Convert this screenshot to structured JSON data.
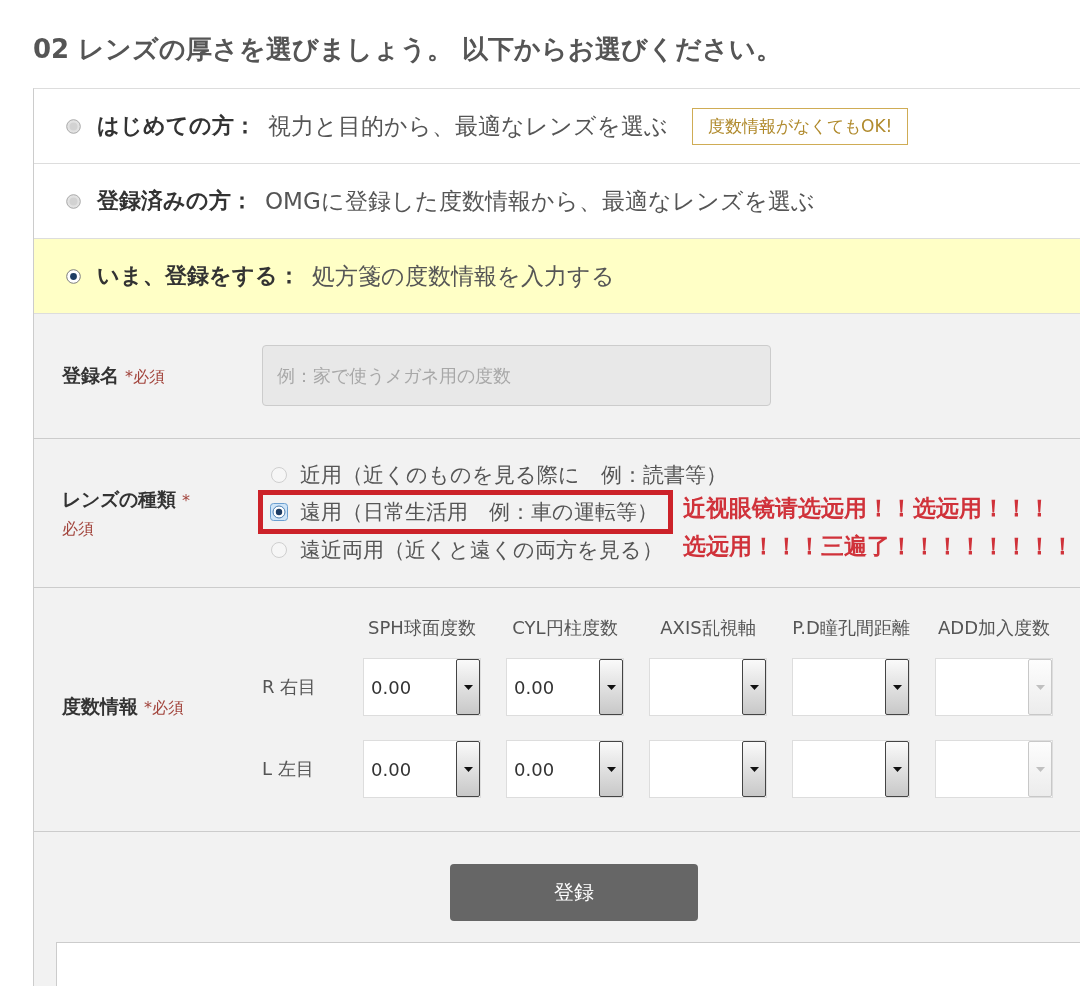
{
  "heading": "02 レンズの厚さを選びましょう。 以下からお選びください。",
  "options": [
    {
      "title": "はじめての方：",
      "description": "視力と目的から、最適なレンズを選ぶ",
      "badge": "度数情報がなくてもOK!",
      "selected": false
    },
    {
      "title": "登録済みの方：",
      "description": "OMGに登録した度数情報から、最適なレンズを選ぶ",
      "selected": false
    },
    {
      "title": "いま、登録をする：",
      "description": "処方箋の度数情報を入力する",
      "selected": true
    }
  ],
  "registration_name": {
    "label": "登録名",
    "required": "*必須",
    "placeholder": "例：家で使うメガネ用の度数"
  },
  "lens_type": {
    "label": "レンズの種類",
    "required": "*",
    "required_note": "必須",
    "choices": [
      {
        "label": "近用（近くのものを見る際に　例：読書等）",
        "selected": false,
        "highlighted": false
      },
      {
        "label": "遠用（日常生活用　例：車の運転等）",
        "selected": true,
        "highlighted": true
      },
      {
        "label": "遠近両用（近くと遠くの両方を見る）",
        "selected": false,
        "highlighted": false
      }
    ],
    "annotation": [
      "近视眼镜请选远用！！选远用！！！",
      "选远用！！！三遍了！！！！！！！！"
    ]
  },
  "prescription": {
    "label": "度数情報",
    "required": "*必須",
    "columns": [
      "SPH球面度数",
      "CYL円柱度数",
      "AXIS乱視軸",
      "P.D瞳孔間距離",
      "ADD加入度数"
    ],
    "rows": [
      {
        "label": "R 右目",
        "cells": [
          {
            "value": "0.00",
            "disabled": false
          },
          {
            "value": "0.00",
            "disabled": false
          },
          {
            "disabled": false
          },
          {
            "disabled": false
          },
          {
            "disabled": true
          }
        ]
      },
      {
        "label": "L 左目",
        "cells": [
          {
            "value": "0.00",
            "disabled": false
          },
          {
            "value": "0.00",
            "disabled": false
          },
          {
            "disabled": false
          },
          {
            "disabled": false
          },
          {
            "disabled": true
          }
        ]
      }
    ]
  },
  "submit_button": "登録"
}
